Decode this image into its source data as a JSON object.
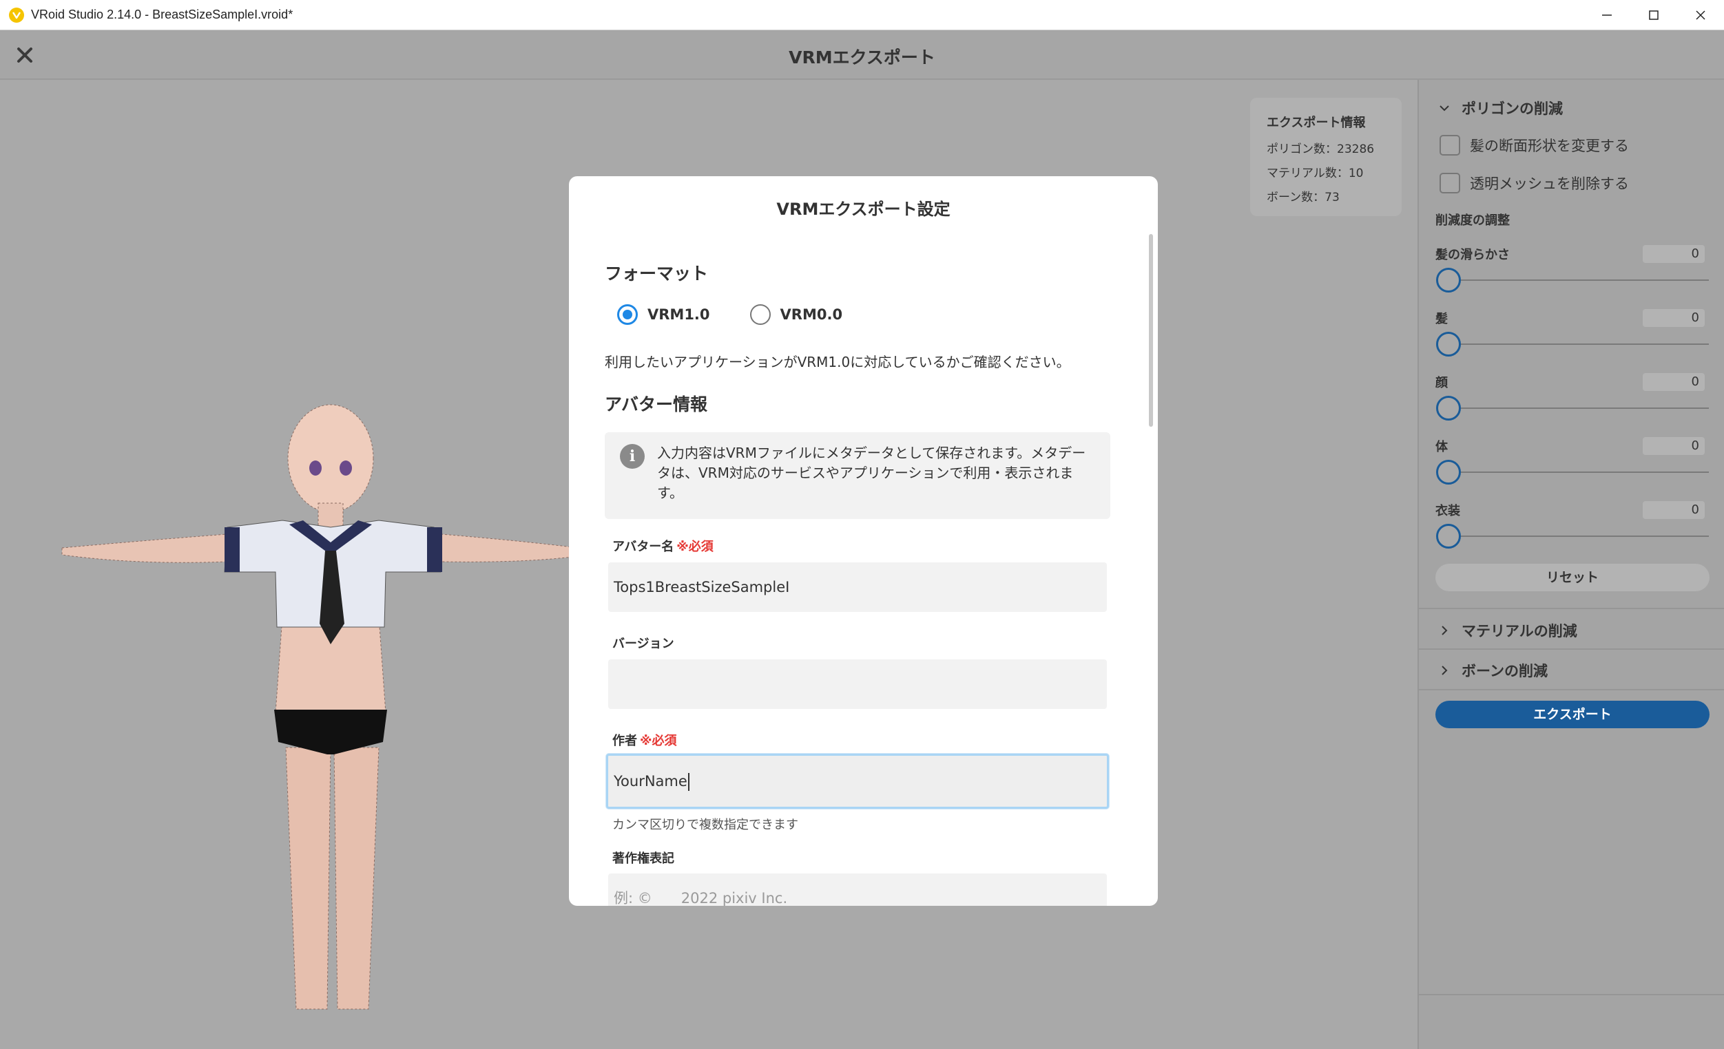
{
  "window": {
    "title": "VRoid Studio 2.14.0 - BreastSizeSampleI.vroid*"
  },
  "header": {
    "title": "VRMエクスポート"
  },
  "export_info": {
    "title": "エクスポート情報",
    "polygons": "ポリゴン数：23286",
    "materials": "マテリアル数：10",
    "bones": "ボーン数：73"
  },
  "panel": {
    "polygon_section": "ポリゴンの削減",
    "check_hair_cross_section": "髪の断面形状を変更する",
    "check_remove_transparent": "透明メッシュを削除する",
    "reduction_label": "削減度の調整",
    "sliders": [
      {
        "label": "髪の滑らかさ",
        "value": "0"
      },
      {
        "label": "髪",
        "value": "0"
      },
      {
        "label": "顔",
        "value": "0"
      },
      {
        "label": "体",
        "value": "0"
      },
      {
        "label": "衣装",
        "value": "0"
      }
    ],
    "reset_label": "リセット",
    "material_section": "マテリアルの削減",
    "bone_section": "ボーンの削減",
    "export_label": "エクスポート"
  },
  "modal": {
    "title": "VRMエクスポート設定",
    "format_heading": "フォーマット",
    "format_options": [
      "VRM1.0",
      "VRM0.0"
    ],
    "selected_format": "VRM1.0",
    "format_note": "利用したいアプリケーションがVRM1.0に対応しているかご確認ください。",
    "avatar_heading": "アバター情報",
    "info_text": "入力内容はVRMファイルにメタデータとして保存されます。メタデータは、VRM対応のサービスやアプリケーションで利用・表示されます。",
    "avatar_name_label": "アバター名",
    "required": "※必須",
    "avatar_name_value": "Tops1BreastSizeSampleI",
    "version_label": "バージョン",
    "version_value": "",
    "author_label": "作者",
    "author_value": "YourName",
    "author_hint": "カンマ区切りで複数指定できます",
    "copyright_label": "著作権表記",
    "copyright_placeholder": "例: ©　　2022 pixiv Inc."
  },
  "colors": {
    "accent": "#1e88e5",
    "export_button": "#1a5c9a",
    "required": "#e53935"
  }
}
